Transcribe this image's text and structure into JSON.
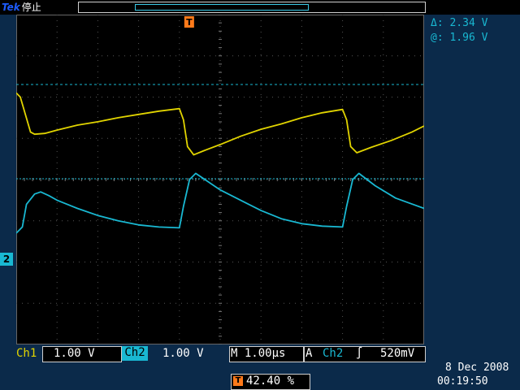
{
  "top": {
    "brand": "Tek",
    "status": "停止"
  },
  "cursors": {
    "delta_label": "Δ:",
    "delta_value": "2.34 V",
    "at_label": "@:",
    "at_value": "1.96 V"
  },
  "markers": {
    "ch2": "2",
    "trigger": "T"
  },
  "bottom": {
    "ch1_label": "Ch1",
    "ch1_scale": "1.00 V",
    "ch2_label": "Ch2",
    "ch2_scale": "1.00 V",
    "timebase": "M 1.00µs",
    "acq_label": "A",
    "trigger_source": "Ch2",
    "trigger_slope_symbol": "∫",
    "trigger_level": "520mV",
    "trigger_position": "42.40 %",
    "date": "8 Dec  2008",
    "time": "00:19:50"
  },
  "chart_data": {
    "type": "line",
    "series": [
      {
        "name": "Ch1",
        "color": "#e1d400",
        "x": [
          0,
          0.1,
          0.35,
          0.45,
          0.7,
          1.0,
          1.5,
          2.0,
          2.5,
          3.0,
          3.5,
          4.0,
          4.1,
          4.2,
          4.35,
          4.6,
          5.0,
          5.5,
          6.0,
          6.5,
          7.0,
          7.5,
          8.0,
          8.1,
          8.2,
          8.35,
          8.7,
          9.2,
          9.7,
          10.0
        ],
        "y": [
          1.1,
          1.0,
          0.15,
          0.1,
          0.12,
          0.2,
          0.32,
          0.4,
          0.5,
          0.58,
          0.66,
          0.72,
          0.45,
          -0.2,
          -0.4,
          -0.3,
          -0.15,
          0.05,
          0.22,
          0.35,
          0.5,
          0.62,
          0.7,
          0.45,
          -0.2,
          -0.35,
          -0.22,
          -0.05,
          0.15,
          0.3
        ]
      },
      {
        "name": "Ch2",
        "color": "#19b8d2",
        "x": [
          0,
          0.15,
          0.25,
          0.45,
          0.6,
          0.8,
          1.0,
          1.5,
          2.0,
          2.5,
          3.0,
          3.5,
          4.0,
          4.1,
          4.25,
          4.4,
          4.7,
          5.0,
          5.5,
          6.0,
          6.5,
          7.0,
          7.5,
          8.0,
          8.1,
          8.25,
          8.4,
          8.8,
          9.3,
          10.0
        ],
        "y": [
          -0.25,
          -0.1,
          0.45,
          0.7,
          0.75,
          0.66,
          0.55,
          0.35,
          0.18,
          0.05,
          -0.05,
          -0.1,
          -0.12,
          0.4,
          1.05,
          1.2,
          1.0,
          0.8,
          0.55,
          0.3,
          0.1,
          -0.02,
          -0.08,
          -0.1,
          0.4,
          1.05,
          1.2,
          0.9,
          0.6,
          0.35
        ]
      }
    ],
    "xlim": [
      0,
      10
    ],
    "ylim": [
      -4,
      4
    ],
    "grid": true
  }
}
